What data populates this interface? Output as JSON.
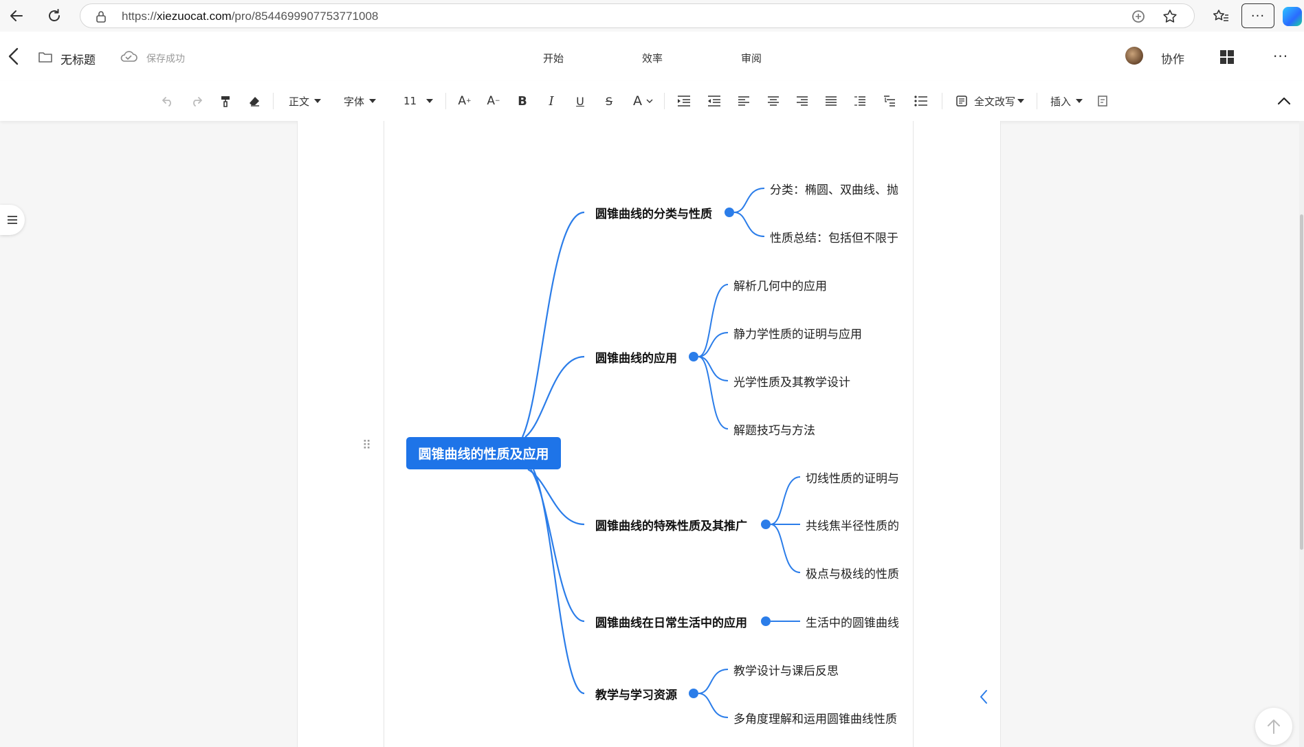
{
  "browser": {
    "url_scheme": "https://",
    "url_host": "xiezuocat.com",
    "url_path": "/pro/8544699907753771008"
  },
  "header": {
    "doc_title": "无标题",
    "save_status": "保存成功",
    "tabs": [
      "开始",
      "效率",
      "审阅"
    ],
    "collab_label": "协作"
  },
  "toolbar": {
    "style_select": "正文",
    "font_select": "字体",
    "size_select": "11",
    "rewrite_label": "全文改写",
    "insert_label": "插入"
  },
  "mindmap": {
    "root": "圆锥曲线的性质及应用",
    "branches": [
      {
        "label": "圆锥曲线的分类与性质",
        "children": [
          "分类：椭圆、双曲线、抛",
          "性质总结：包括但不限于"
        ]
      },
      {
        "label": "圆锥曲线的应用",
        "children": [
          "解析几何中的应用",
          "静力学性质的证明与应用",
          "光学性质及其教学设计",
          "解题技巧与方法"
        ]
      },
      {
        "label": "圆锥曲线的特殊性质及其推广",
        "children": [
          "切线性质的证明与",
          "共线焦半径性质的",
          "极点与极线的性质"
        ]
      },
      {
        "label": "圆锥曲线在日常生活中的应用",
        "children": [
          "生活中的圆锥曲线"
        ]
      },
      {
        "label": "教学与学习资源",
        "children": [
          "教学设计与课后反思",
          "多角度理解和运用圆锥曲线性质"
        ]
      }
    ],
    "line_color": "#2b7de9",
    "root_color": "#1e74e8"
  }
}
